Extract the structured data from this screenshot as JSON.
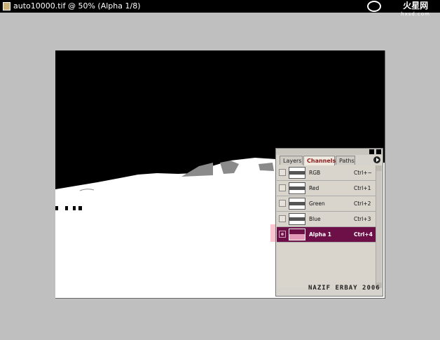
{
  "window": {
    "title": "auto10000.tif @ 50% (Alpha 1/8)"
  },
  "watermark": {
    "text": "火星网",
    "sub": "hxsd.com"
  },
  "panel": {
    "tabs": [
      {
        "label": "Layers",
        "active": false
      },
      {
        "label": "Channels",
        "active": true
      },
      {
        "label": "Paths",
        "active": false
      }
    ],
    "channels": [
      {
        "name": "RGB",
        "shortcut": "Ctrl+~",
        "selected": false
      },
      {
        "name": "Red",
        "shortcut": "Ctrl+1",
        "selected": false
      },
      {
        "name": "Green",
        "shortcut": "Ctrl+2",
        "selected": false
      },
      {
        "name": "Blue",
        "shortcut": "Ctrl+3",
        "selected": false
      },
      {
        "name": "Alpha 1",
        "shortcut": "Ctrl+4",
        "selected": true
      }
    ]
  },
  "signature": "NAZIF ERBAY 2006",
  "colors": {
    "selected_row": "#6e1048",
    "highlight": "#f596a5",
    "canvas": "#000000",
    "background": "#bfbfbf"
  }
}
